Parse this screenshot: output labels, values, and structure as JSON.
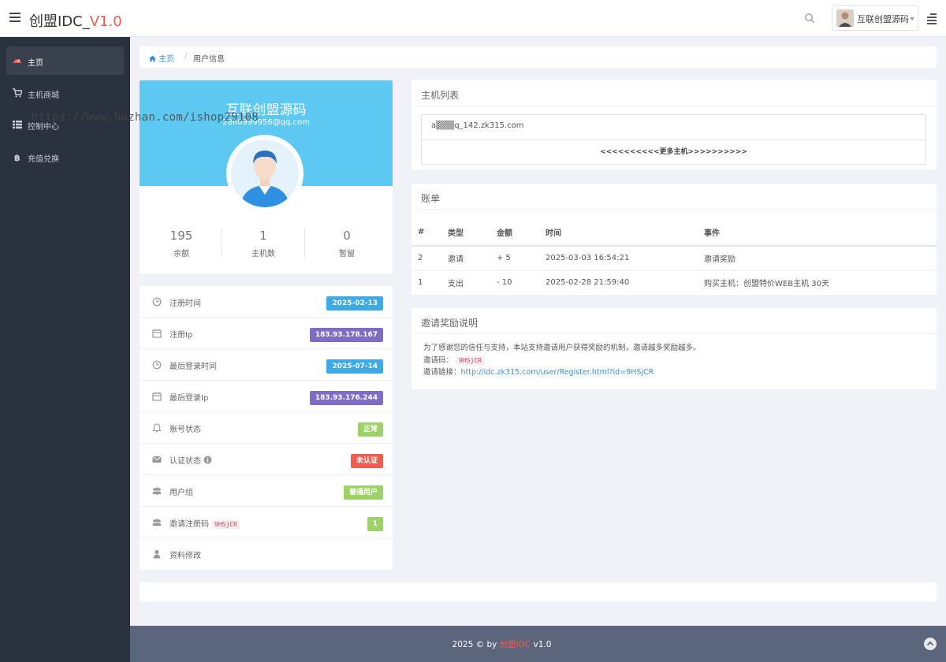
{
  "header": {
    "brand": "创盟IDC_",
    "version": "V1.0",
    "user_name": "互联创盟源码",
    "icons": [
      "menu-icon",
      "search-icon",
      "chevron-down-icon",
      "right-menu-icon"
    ]
  },
  "sidebar": {
    "items": [
      {
        "label": "主页",
        "icon": "dashboard-icon",
        "active": true
      },
      {
        "label": "主机商城",
        "icon": "cart-icon"
      },
      {
        "label": "控制中心",
        "icon": "list-icon"
      },
      {
        "label": "充值兑换",
        "icon": "bitcoin-icon"
      }
    ],
    "watermark": "https://www.huzhan.com/ishop29108"
  },
  "breadcrumb": {
    "home": "主页",
    "current": "用户信息"
  },
  "profile": {
    "name": "互联创盟源码",
    "email": "2860999956@qq.com",
    "stats": [
      {
        "value": "195",
        "label": "余额"
      },
      {
        "value": "1",
        "label": "主机数"
      },
      {
        "value": "0",
        "label": "暂留"
      }
    ]
  },
  "info": [
    {
      "label": "注册时间",
      "icon": "clock-icon",
      "badge": "2025-02-13",
      "color": "#3fa9e5"
    },
    {
      "label": "注册Ip",
      "icon": "calendar-icon",
      "badge": "183.93.178.167",
      "color": "#7e6cc5"
    },
    {
      "label": "最后登录时间",
      "icon": "clock-icon",
      "badge": "2025-07-14",
      "color": "#3fa9e5"
    },
    {
      "label": "最后登录Ip",
      "icon": "calendar-icon",
      "badge": "183.93.176.244",
      "color": "#7e6cc5"
    },
    {
      "label": "账号状态",
      "icon": "bell-icon",
      "badge": "正常",
      "color": "#9fd16a"
    },
    {
      "label": "认证状态",
      "icon": "envelope-icon",
      "badge": "未认证",
      "color": "#f25c54"
    },
    {
      "label": "用户组",
      "icon": "users-icon",
      "badge": "普通用户",
      "color": "#9fd16a"
    },
    {
      "label": "邀请注册码",
      "icon": "users-icon",
      "badge": "1",
      "color": "#9fd16a",
      "code": "9HSjCR"
    },
    {
      "label": "资料修改",
      "icon": "user-icon"
    }
  ],
  "hosts": {
    "title": "主机列表",
    "host": "a▒▒▒q_142.zk315.com",
    "more": "<<<<<<<<<<更多主机>>>>>>>>>>"
  },
  "bills": {
    "title": "账单",
    "columns": [
      "#",
      "类型",
      "金额",
      "时间",
      "事件"
    ],
    "rows": [
      [
        "2",
        "邀请",
        "+ 5",
        "2025-03-03 16:54:21",
        "邀请奖励"
      ],
      [
        "1",
        "支出",
        "- 10",
        "2025-02-28 21:59:40",
        "购买主机：创盟特价WEB主机 30天"
      ]
    ]
  },
  "invite": {
    "title": "邀请奖励说明",
    "desc": "为了感谢您的信任与支持，本站支持邀请用户获得奖励的机制，邀请越多奖励越多。",
    "code_label": "邀请码：",
    "code": "9HSjCR",
    "link_label": "邀请链接：",
    "link": "http://idc.zk315.com/user/Register.html?id=9HSjCR"
  },
  "footer": {
    "prefix": "2025 © by ",
    "brand": "创盟IDC",
    "suffix": " v1.0"
  }
}
